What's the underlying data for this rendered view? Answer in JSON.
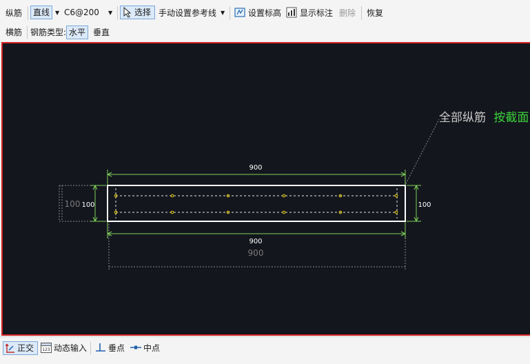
{
  "toolbar_row1": {
    "longitudinal_bar_label": "纵筋",
    "line_mode_label": "直线",
    "rebar_spec": "C6@200",
    "select_label": "选择",
    "manual_reference_line_label": "手动设置参考线",
    "set_elevation_label": "设置标高",
    "show_dimension_label": "显示标注",
    "delete_label": "删除",
    "restore_label": "恢复"
  },
  "toolbar_row2": {
    "transverse_bar_label": "横筋",
    "rebar_type_label": "钢筋类型:",
    "horizontal_label": "水平",
    "vertical_label": "垂直"
  },
  "drawing": {
    "top_dimension": "900",
    "bottom_dimension": "900",
    "outer_bottom_dimension": "900",
    "left_dimension_outer": "100",
    "left_dimension_inner": "100",
    "right_dimension": "100",
    "annotation_prefix": "全部纵筋",
    "annotation_suffix": "按截面",
    "annotation_prefix_color": "#c8c8c8",
    "annotation_suffix_color": "#3bd13b",
    "dimension_color": "#7fd35a",
    "outline_color": "#ffffff",
    "rebar_point_color": "#e6d200"
  },
  "statusbar": {
    "orthogonal_label": "正交",
    "dynamic_input_label": "动态输入",
    "perpendicular_label": "垂点",
    "midpoint_label": "中点"
  }
}
